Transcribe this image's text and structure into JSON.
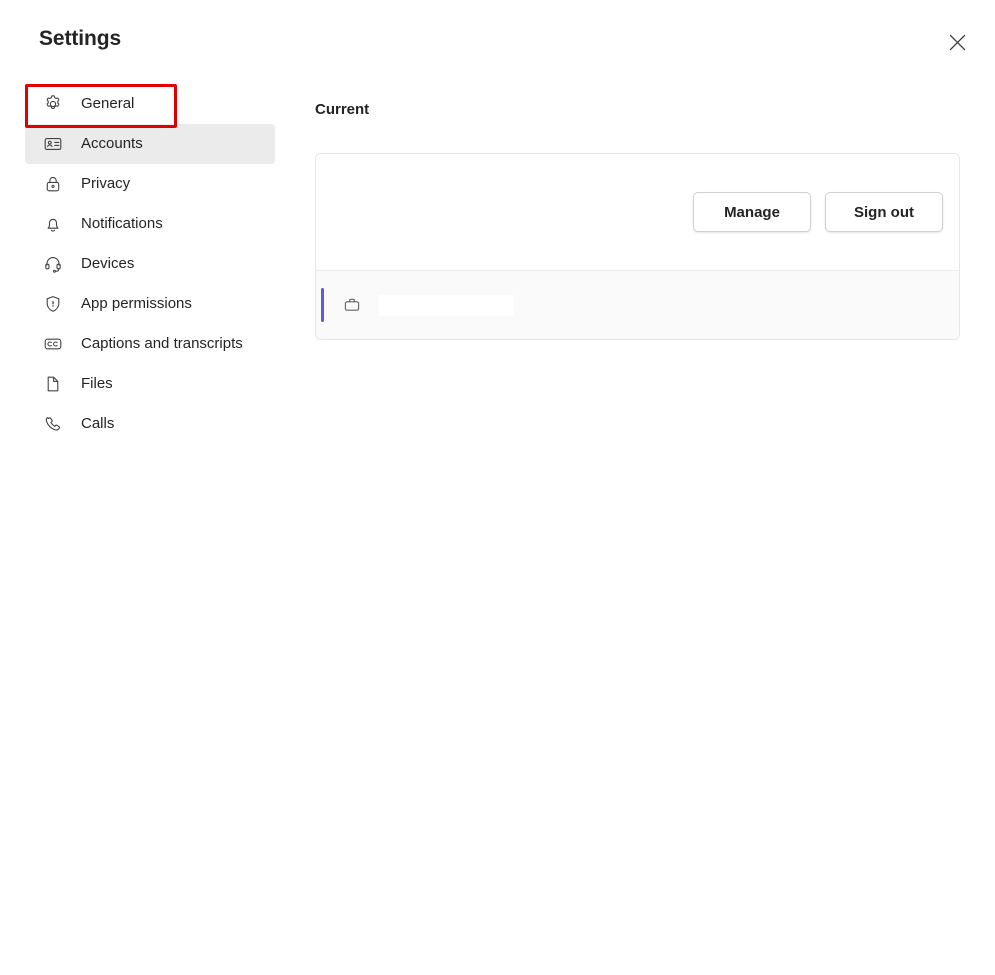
{
  "window": {
    "title": "Settings",
    "close_icon": "close-icon"
  },
  "sidebar": {
    "items": [
      {
        "label": "General",
        "icon": "gear-icon",
        "selected": false,
        "annotated": true
      },
      {
        "label": "Accounts",
        "icon": "contact-card-icon",
        "selected": true,
        "annotated": false
      },
      {
        "label": "Privacy",
        "icon": "lock-icon",
        "selected": false,
        "annotated": false
      },
      {
        "label": "Notifications",
        "icon": "bell-icon",
        "selected": false,
        "annotated": false
      },
      {
        "label": "Devices",
        "icon": "headset-icon",
        "selected": false,
        "annotated": false
      },
      {
        "label": "App permissions",
        "icon": "shield-icon",
        "selected": false,
        "annotated": false
      },
      {
        "label": "Captions and transcripts",
        "icon": "closed-caption-icon",
        "selected": false,
        "annotated": false
      },
      {
        "label": "Files",
        "icon": "document-icon",
        "selected": false,
        "annotated": false
      },
      {
        "label": "Calls",
        "icon": "phone-icon",
        "selected": false,
        "annotated": false
      }
    ]
  },
  "main": {
    "section_heading": "Current",
    "buttons": {
      "manage_label": "Manage",
      "sign_out_label": "Sign out"
    },
    "account_row": {
      "icon": "briefcase-icon",
      "name": "",
      "redacted": true
    }
  },
  "colors": {
    "annotation_red": "#e00000",
    "selected_item_bg": "#ebebeb",
    "accent_bar": "#5b5fc7",
    "text_primary": "#242424",
    "card_border": "#e6e6e6",
    "row_bg": "#fafafa"
  }
}
